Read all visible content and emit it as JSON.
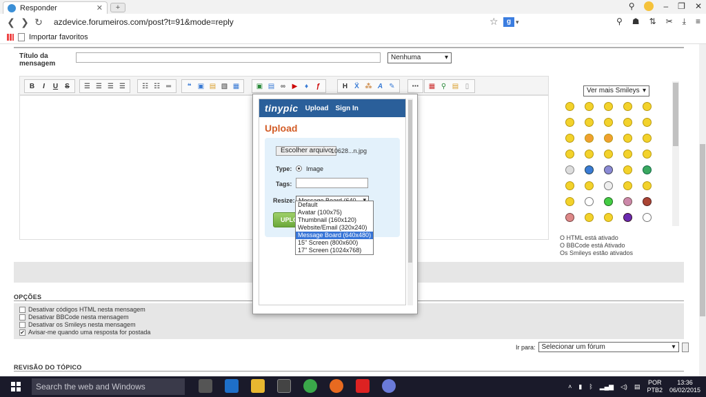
{
  "browser": {
    "tab_title": "Responder",
    "url": "azdevice.forumeiros.com/post?t=91&mode=reply",
    "bookmark": "Importar favoritos"
  },
  "form": {
    "title_label": "Título da mensagem",
    "icon_select": "Nenhuma",
    "smiley_select": "Ver mais Smileys",
    "status_html": "O HTML está ativado",
    "status_bbcode": "O BBCode está Ativado",
    "status_smileys": "Os Smileys estão ativados"
  },
  "toolbar": {
    "bold": "B",
    "italic": "I",
    "underline": "U",
    "strike": "S",
    "heading": "H",
    "font_a": "A"
  },
  "options": {
    "title": "OPÇÕES",
    "opt1": "Desativar códigos HTML nesta mensagem",
    "opt2": "Desativar BBCode nesta mensagem",
    "opt3": "Desativar os Smileys nesta mensagem",
    "opt4": "Avisar-me quando uma resposta for postada"
  },
  "jump": {
    "label": "Ir para:",
    "select": "Selecionar um fórum"
  },
  "review": {
    "title": "REVISÃO DO TÓPICO"
  },
  "tinypic": {
    "logo": "tinypic",
    "upload_link": "Upload",
    "signin_link": "Sign In",
    "heading": "Upload",
    "file_button": "Escolher arquivo",
    "file_name": "10628...n.jpg",
    "type_label": "Type:",
    "type_value": "Image",
    "tags_label": "Tags:",
    "resize_label": "Resize:",
    "resize_value": "Message Board (640",
    "upload_button": "UPLO",
    "resize_options": [
      "Default",
      "Avatar (100x75)",
      "Thumbnail (160x120)",
      "Website/Email (320x240)",
      "Message Board (640x480)",
      "15\" Screen (800x600)",
      "17\" Screen (1024x768)"
    ]
  },
  "taskbar": {
    "search_placeholder": "Search the web and Windows",
    "lang1": "POR",
    "lang2": "PTB2",
    "time": "13:36",
    "date": "06/02/2015"
  }
}
